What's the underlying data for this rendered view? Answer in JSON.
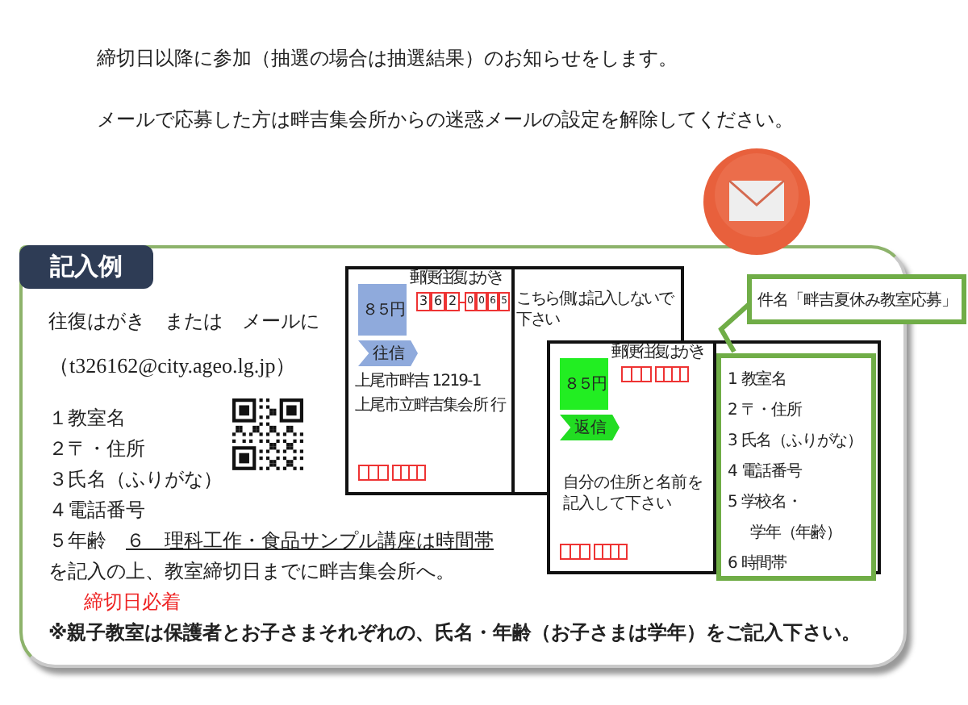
{
  "intro": [
    "締切日以降に参加（抽選の場合は抽選結果）のお知らせをします。",
    "メールで応募した方は畔吉集会所からの迷惑メールの設定を解除してください。"
  ],
  "panel": {
    "title": "記入例",
    "lead": "往復はがき　または　メールに",
    "email": "（t326162@city.ageo.lg.jp）",
    "items": [
      "１教室名",
      "２〒・住所",
      "３氏名（ふりがな）",
      "４電話番号"
    ],
    "age_line": {
      "text": "５年齢",
      "note": "６　理科工作・食品サンプル講座は時間帯"
    },
    "instruction": "を記入の上、教室締切日までに畔吉集会所へ。",
    "deadline": "締切日必着",
    "footnote": "※親子教室は保護者とお子さまそれぞれの、氏名・年齢（お子さまは学年）をご記入下さい。"
  },
  "postcards": [
    {
      "kind": "outgoing",
      "header": "郵便往復はがき",
      "stamp": "８５円",
      "tag": "往信",
      "postal_digits": [
        "3",
        "6",
        "2",
        "0",
        "0",
        "6",
        "5"
      ],
      "address_lines": [
        "上尾市畔吉 1219-1",
        "上尾市立畔吉集会所 行"
      ],
      "side_note": "こちら側は記入しないで下さい"
    },
    {
      "kind": "reply",
      "header": "郵便往復はがき",
      "stamp": "８５円",
      "tag": "返信",
      "note": "自分の住所と名前を記入して下さい",
      "list": [
        "1  教室名",
        "2  〒・住所",
        "3  氏名（ふりがな）",
        "4  電話番号",
        "5  学校名・",
        "学年（年齢）",
        "6  時間帯"
      ]
    }
  ],
  "subject_callout": "件名「畔吉夏休み教室応募」"
}
